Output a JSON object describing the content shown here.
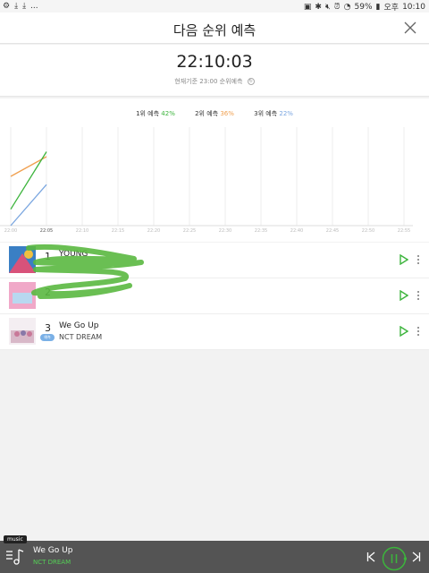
{
  "statusbar": {
    "left_extra": "...",
    "battery": "59%",
    "ampm": "오후",
    "clock": "10:10"
  },
  "header": {
    "title": "다음 순위 예측"
  },
  "time_panel": {
    "time": "22:10:03",
    "basis_label": "현재기준 23:00 순위예측"
  },
  "chart_data": {
    "type": "line",
    "legend": [
      {
        "label": "1위 예측",
        "value": "42%",
        "color": "#3cb43c"
      },
      {
        "label": "2위 예측",
        "value": "36%",
        "color": "#f0a050"
      },
      {
        "label": "3위 예측",
        "value": "22%",
        "color": "#7aa6e0"
      }
    ],
    "x": [
      "22:00",
      "22:05",
      "22:10",
      "22:15",
      "22:20",
      "22:25",
      "22:30",
      "22:35",
      "22:40",
      "22:45",
      "22:50",
      "22:55"
    ],
    "series": [
      {
        "color": "#f0a050",
        "values": [
          30,
          42,
          null,
          null,
          null,
          null,
          null,
          null,
          null,
          null,
          null,
          null
        ]
      },
      {
        "color": "#3cb43c",
        "values": [
          10,
          45,
          null,
          null,
          null,
          null,
          null,
          null,
          null,
          null,
          null,
          null
        ]
      },
      {
        "color": "#7aa6e0",
        "values": [
          0,
          25,
          null,
          null,
          null,
          null,
          null,
          null,
          null,
          null,
          null,
          null
        ]
      }
    ],
    "ylim": [
      0,
      60
    ],
    "grid": true
  },
  "ranks": [
    {
      "rank": "1",
      "song": "YOUNG",
      "artist": "",
      "badge": ""
    },
    {
      "rank": "2",
      "song": "",
      "artist": "",
      "badge": ""
    },
    {
      "rank": "3",
      "song": "We Go Up",
      "artist": "NCT DREAM",
      "badge": "예측"
    }
  ],
  "player": {
    "tag": "music",
    "now_playing": "We Go Up",
    "artist": "NCT DREAM"
  }
}
